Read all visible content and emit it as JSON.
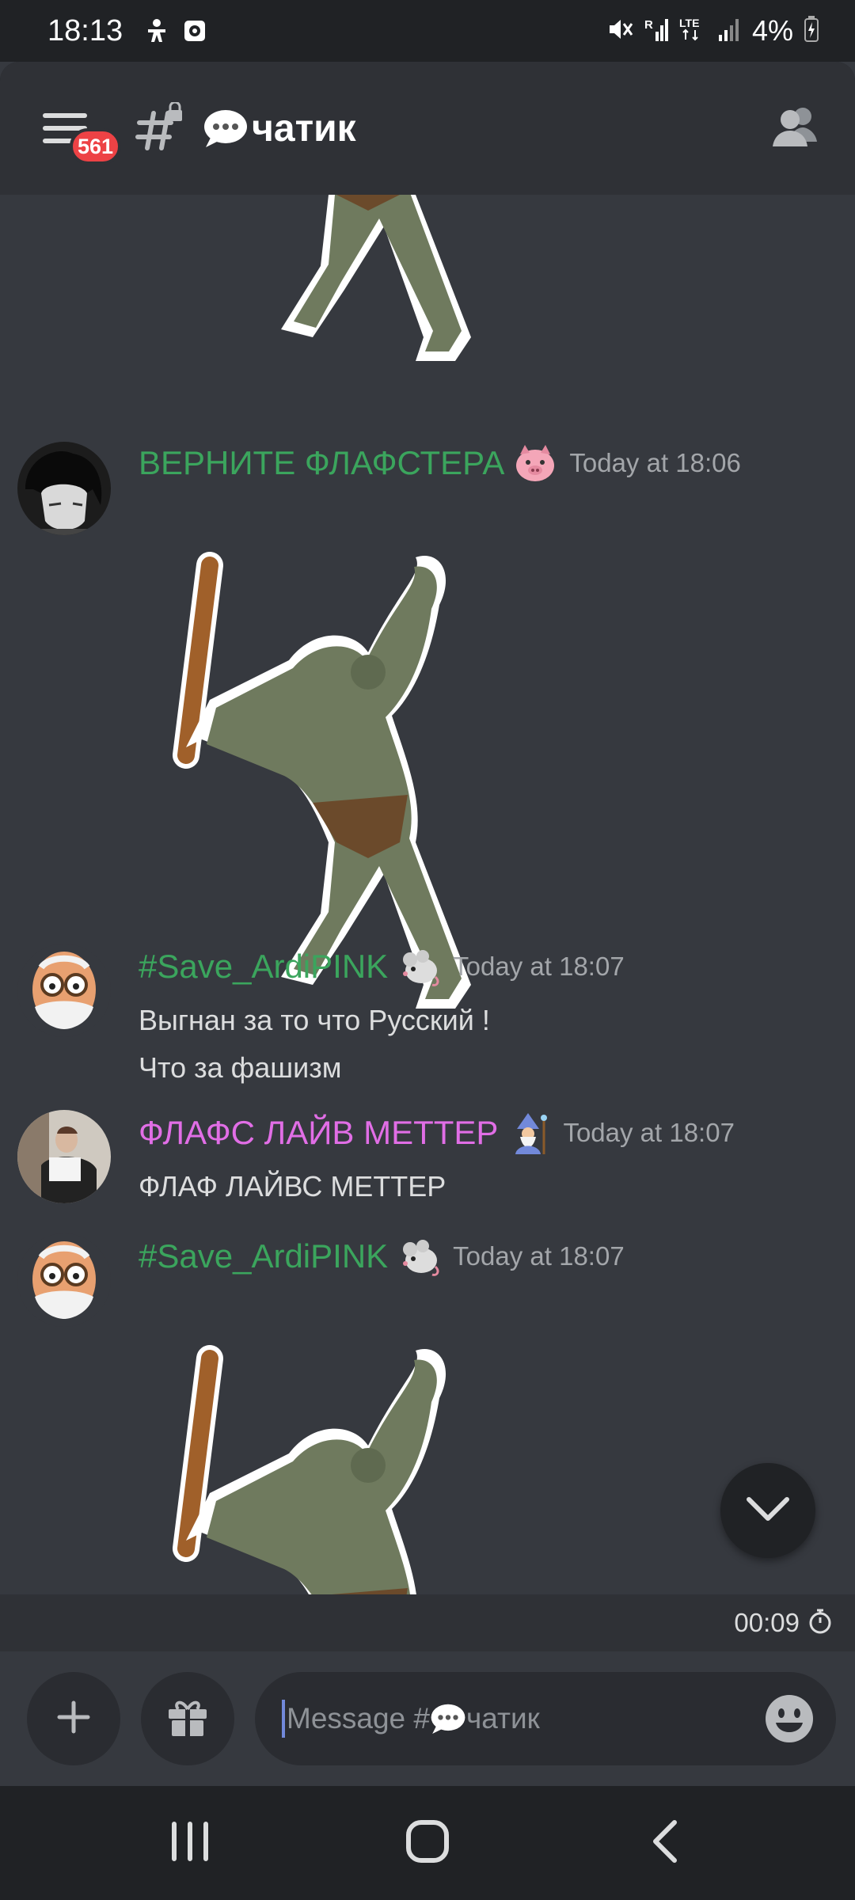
{
  "status_bar": {
    "time": "18:13",
    "battery": "4%"
  },
  "header": {
    "badge_count": "561",
    "channel_name": "чатик"
  },
  "messages": [
    {
      "username": "ВЕРНИТЕ ФЛАФСТЕРА",
      "username_color": "#3ba55d",
      "timestamp": "Today at 18:06"
    },
    {
      "username": "#Save_ArdiPINK",
      "username_color": "#3ba55d",
      "timestamp": "Today at 18:07",
      "lines": [
        "Выгнан за то что Русский !",
        "Что за фашизм"
      ]
    },
    {
      "username": "ФЛАФС ЛАЙВ МЕТТЕР",
      "username_color": "#e16ee6",
      "timestamp": "Today at 18:07",
      "lines": [
        "ФЛАФ ЛАЙВС МЕТТЕР"
      ]
    },
    {
      "username": "#Save_ArdiPINK",
      "username_color": "#3ba55d",
      "timestamp": "Today at 18:07"
    }
  ],
  "slowmode": {
    "remaining": "00:09"
  },
  "composer": {
    "placeholder_prefix": "Message #",
    "placeholder_channel": "чатик"
  },
  "colors": {
    "background": "#36393f",
    "header": "#2f3136",
    "accent": "#7289da",
    "badge": "#ed4245"
  }
}
